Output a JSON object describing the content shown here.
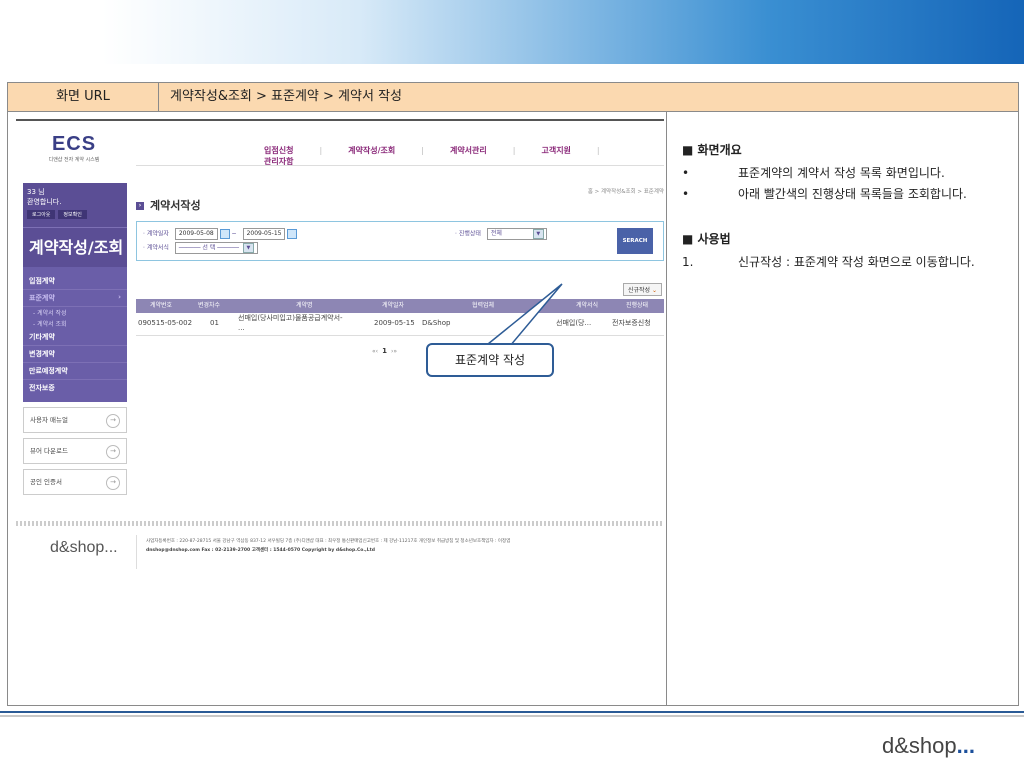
{
  "header": {
    "label": "화면 URL",
    "path": "계약작성&조회 > 표준계약 > 계약서 작성"
  },
  "app": {
    "logo_big": "ECS",
    "logo_small": "디앤샵 전자 계약 시스템",
    "gnav": [
      "입점신청",
      "계약작성/조회",
      "계약서관리",
      "고객지원",
      "관리자함"
    ],
    "user": {
      "name": "33 님",
      "greeting": "환영합니다.",
      "logout_button": "로그아웃",
      "info_button": "정보확인"
    },
    "section_title": "계약작성/조회",
    "menu": {
      "items": [
        "입점계약",
        "표준계약"
      ],
      "sub_items": [
        "- 계약서 작성",
        "- 계약서 조회"
      ],
      "more_items": [
        "기타계약",
        "변경계약",
        "만료예정계약",
        "전자보증"
      ]
    },
    "side_buttons": [
      "사용자 매뉴얼",
      "뷰어 다운로드",
      "공인 인증서"
    ],
    "page_title": "계약서작성",
    "breadcrumb": "홈 > 계약작성&조회 > 표준계약",
    "search": {
      "date_label": "· 계약일자",
      "date_from": "2009-05-08",
      "date_sep": "~",
      "date_to": "2009-05-15",
      "form_label": "· 계약서식",
      "form_value": "────── 선 택 ──────",
      "status_label": "· 진행상태",
      "status_value": "전체",
      "search_button": "SERACH"
    },
    "new_button": "신규작성",
    "table": {
      "columns": [
        "계약번호",
        "변경차수",
        "계약명",
        "계약일자",
        "협력업체",
        "계약서식",
        "진행상태"
      ],
      "rows": [
        [
          "090515-05-002",
          "01",
          "선매입(당사미입고)물품공급계약서-",
          "2009-05-15",
          "D&Shop",
          "선매입(당...",
          "전자보증신청"
        ]
      ],
      "row_cont": "..."
    },
    "pager": {
      "prev": "«‹",
      "current": "1",
      "next": "›»"
    },
    "footer_logo": "d&shop...",
    "footer_line1": "사업자등록번호 : 220-87-28715 서울 강남구 역삼동 837-12 서우빌딩 7층 (주)디앤샵 대표 : 최우정 통신판매업신고번호 : 제 강남-11217호 개인정보 취급방침 및 청소년보호책임자 : 이정엽",
    "footer_line2": "dnshop@dnshop.com Fax : 02-2139-2700 고객센터 : 1544-0570 Copyright by d&shop.Co.,Ltd"
  },
  "callout": "표준계약 작성",
  "description": {
    "overview_title": "■ 화면개요",
    "overview": [
      {
        "mark": "•",
        "text": "표준계약의 계약서 작성 목록 화면입니다."
      },
      {
        "mark": "•",
        "text": "아래 빨간색의 진행상태 목록들을 조회합니다."
      }
    ],
    "usage_title": "■ 사용법",
    "usage": [
      {
        "mark": "1.",
        "text": "신규작성 : 표준계약 작성 화면으로 이동합니다."
      }
    ]
  },
  "brand": {
    "logo_text": "d&shop",
    "logo_dots": "..."
  },
  "colors": {
    "header_bg": "#fbd9b0",
    "sidebar_bg": "#5b4e95",
    "callout_border": "#2e5c96"
  }
}
